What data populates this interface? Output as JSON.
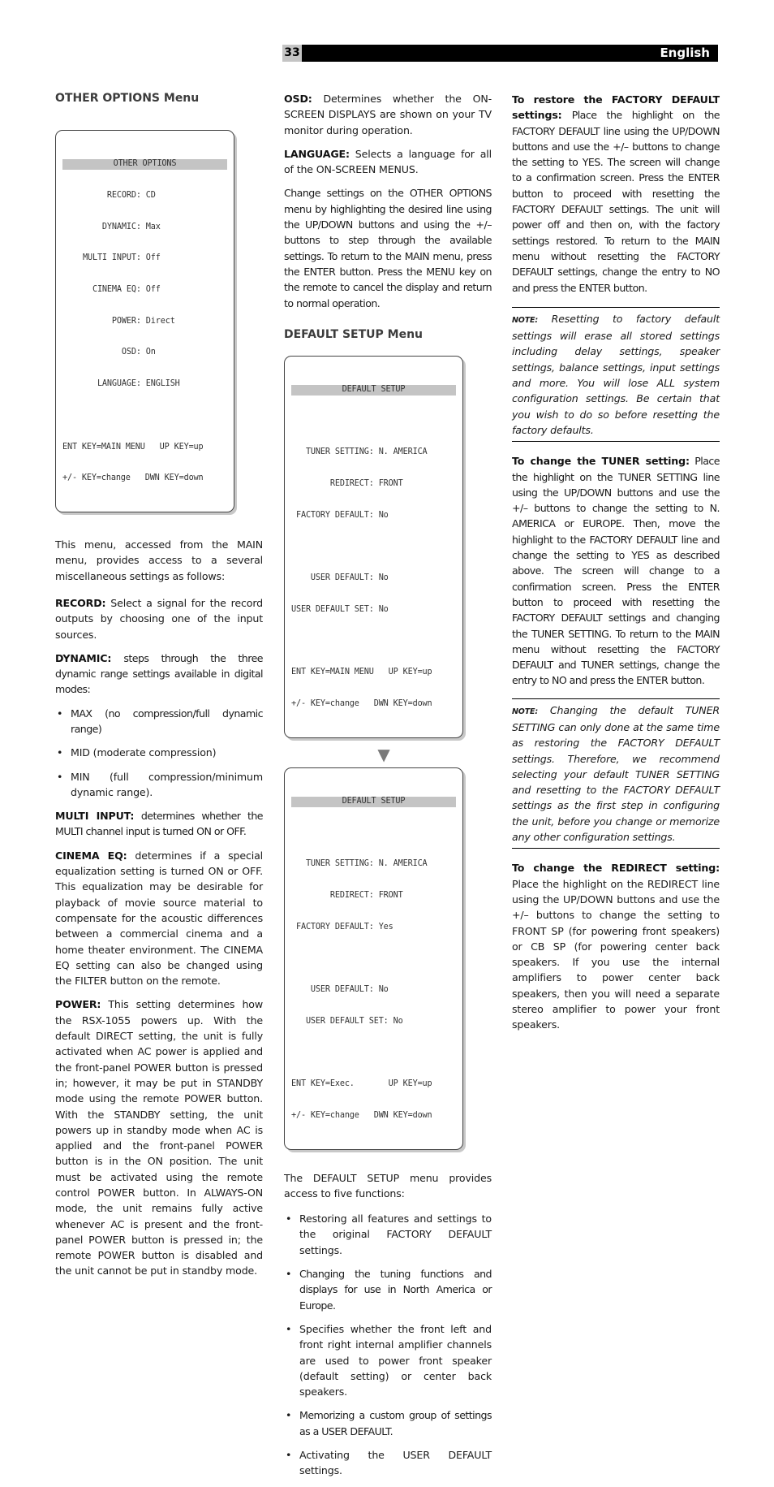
{
  "header": {
    "page_number": "33",
    "language": "English"
  },
  "col1": {
    "heading": "OTHER OPTIONS Menu",
    "screen": {
      "title": "OTHER OPTIONS",
      "rows": [
        "     RECORD: CD",
        "    DYNAMIC: Max",
        "MULTI INPUT: Off",
        "  CINEMA EQ: Off",
        "      POWER: Direct",
        "        OSD: On",
        "   LANGUAGE: ENGLISH"
      ],
      "footer": [
        "ENT KEY=MAIN MENU   UP KEY=up",
        "+/- KEY=change   DWN KEY=down"
      ]
    },
    "intro": "This menu, accessed from the MAIN menu, provides access to a several miscellaneous settings as follows:",
    "record": {
      "label": "RECORD:",
      "text": " Select a signal for the record outputs by choosing one of the input sources."
    },
    "dynamic": {
      "label": "DYNAMIC:",
      "text": " steps through the three dynamic range settings available in digital modes:"
    },
    "dynamic_options": [
      "MAX (no compression/full dynamic range)",
      "MID (moderate compression)",
      "MIN (full compression/minimum dynamic range)."
    ],
    "multi_input": {
      "label": "MULTI INPUT:",
      "text": " determines whether the MULTI channel input is turned ON or OFF."
    },
    "cinema_eq": {
      "label": "CINEMA EQ:",
      "text": " determines if a special equalization setting is turned ON or OFF. This equalization may be desirable for playback of movie source material to compensate for the acoustic differences between a commercial cinema and a home theater environment. The CINEMA EQ setting can also be changed using the FILTER button on the remote."
    },
    "power": {
      "label": "POWER:",
      "text": " This setting determines how the RSX-1055 powers up. With the default DIRECT setting, the unit is fully activated when AC power is applied and the front-panel POWER button is pressed in; however, it may be put in STANDBY mode using the remote POWER button. With the STANDBY setting, the unit powers up in standby mode when AC is applied and the front-panel POWER button is in the ON position. The unit must be activated using the remote control POWER button. In ALWAYS-ON mode, the unit remains fully active whenever AC is present and the front-panel POWER button is pressed in; the remote POWER button is disabled and the unit cannot be put in standby mode."
    }
  },
  "col2": {
    "osd": {
      "label": "OSD:",
      "text": " Determines whether the ON-SCREEN DISPLAYS are shown on your TV monitor during operation."
    },
    "language": {
      "label": "LANGUAGE:",
      "text": " Selects a language for all of the ON-SCREEN MENUS."
    },
    "change_settings": "Change settings on the OTHER OPTIONS menu by highlighting the desired line using the UP/DOWN buttons and using the +/– buttons to step through the available settings. To return to the MAIN menu, press the ENTER button. Press the MENU key on the remote to cancel the display and return to normal operation.",
    "heading": "DEFAULT SETUP Menu",
    "screen1": {
      "title": "DEFAULT SETUP",
      "rows": [
        "",
        "   TUNER SETTING: N. AMERICA",
        "        REDIRECT: FRONT",
        " FACTORY DEFAULT: No",
        "",
        "    USER DEFAULT: No",
        "USER DEFAULT SET: No"
      ],
      "footer": [
        "ENT KEY=MAIN MENU   UP KEY=up",
        "+/- KEY=change   DWN KEY=down"
      ]
    },
    "arrow": "▼",
    "screen2": {
      "title": "DEFAULT SETUP",
      "rows": [
        "",
        "   TUNER SETTING: N. AMERICA",
        "        REDIRECT: FRONT",
        " FACTORY DEFAULT: Yes",
        "",
        "    USER DEFAULT: No",
        "   USER DEFAULT SET: No"
      ],
      "footer": [
        "ENT KEY=Exec.       UP KEY=up",
        "+/- KEY=change   DWN KEY=down"
      ]
    },
    "intro": "The DEFAULT SETUP menu provides access to five functions:",
    "functions": [
      "Restoring all features and settings to the original FACTORY DEFAULT settings.",
      "Changing the tuning functions and displays for use in North America or Europe.",
      "Specifies whether the front left and front right internal amplifier channels are used to power front speaker (default setting) or center back speakers.",
      "Memorizing a custom group of settings as a USER DEFAULT.",
      "Activating the USER DEFAULT settings."
    ]
  },
  "col3": {
    "restore": {
      "label": "To restore the FACTORY DEFAULT settings:",
      "text": " Place the highlight on the FACTORY DEFAULT line using the UP/DOWN buttons and use the +/– buttons to change the setting to YES. The screen will change to a confirmation screen. Press the ENTER button to proceed with resetting the FACTORY DEFAULT settings. The unit will power off and then on, with the factory settings restored. To return to the MAIN menu without resetting the FACTORY DEFAULT settings, change the entry to NO and press the ENTER button."
    },
    "note1": {
      "label": "NOTE:",
      "text": " Resetting to factory default settings will erase all stored settings including delay settings, speaker settings, balance settings, input settings and more. You will lose ALL system configuration settings. Be certain that you wish to do so before resetting the factory defaults."
    },
    "tuner": {
      "label": "To change the TUNER setting:",
      "text": " Place the highlight on the TUNER SETTING line using the UP/DOWN buttons and use the +/– buttons to change the setting to N. AMERICA or EUROPE. Then, move the highlight to the FACTORY DEFAULT line and change the setting to YES as described above. The screen will change to a confirmation screen. Press the ENTER button to proceed with resetting the FACTORY DEFAULT settings and changing the TUNER SETTING. To return to the MAIN menu without resetting the FACTORY DEFAULT and TUNER settings, change the entry to NO and press the ENTER button."
    },
    "note2": {
      "label": "NOTE:",
      "text": " Changing the default TUNER SETTING can only done at the same time as restoring the FACTORY DEFAULT settings. Therefore, we recommend selecting your default TUNER SETTING and resetting to the FACTORY DEFAULT settings as the first step in configuring the unit, before you change or memorize any other configuration settings."
    },
    "redirect": {
      "label": "To change the REDIRECT setting:",
      "text": " Place the highlight on the REDIRECT line using the UP/DOWN buttons and use the +/– buttons to change the setting to FRONT SP (for powering front speakers) or CB SP (for powering center back speakers. If you use the internal amplifiers to power center back speakers, then you will need a separate stereo amplifier to power your front speakers."
    }
  }
}
